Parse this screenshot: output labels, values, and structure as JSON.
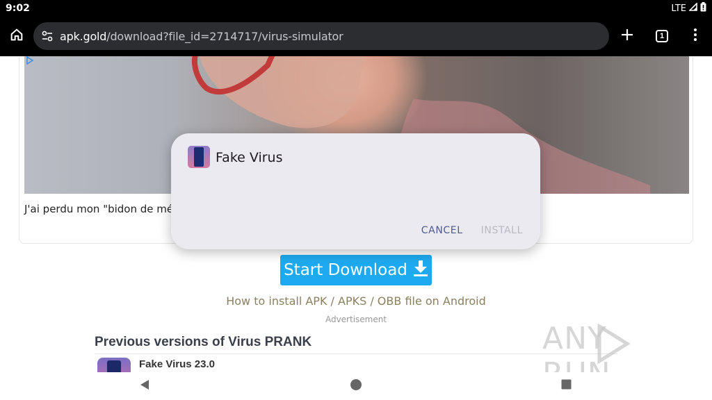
{
  "status_bar": {
    "time": "9:02",
    "network": "LTE"
  },
  "browser": {
    "url_domain": "apk.gold",
    "url_path": "/download?file_id=2714717/virus-simulator",
    "tab_count": "1"
  },
  "page": {
    "ad_caption": "J'ai perdu mon \"bidon de méne",
    "start_download_label": "Start Download",
    "how_to_link": "How to install APK / APKS / OBB file on Android",
    "ad_label": "Advertisement",
    "previous_versions_title": "Previous versions of Virus PRANK",
    "previous_versions": [
      {
        "name": "Fake Virus 23.0"
      }
    ]
  },
  "dialog": {
    "app_name": "Fake Virus",
    "cancel_label": "CANCEL",
    "install_label": "INSTALL"
  },
  "watermark": {
    "text": "ANY RUN"
  },
  "colors": {
    "accent_button": "#1eaaf0",
    "link": "#8a8060",
    "dialog_bg": "#eceaf1",
    "cancel": "#4c5b8c",
    "install_disabled": "#b8b8c0"
  },
  "icons": {
    "home": "home-icon",
    "site_info": "tune-icon",
    "new_tab": "plus-icon",
    "tabs": "tab-switcher-icon",
    "menu": "more-vertical-icon",
    "download": "download-arrow-icon",
    "nav_back": "triangle-back-icon",
    "nav_home": "circle-home-icon",
    "nav_recents": "square-recents-icon"
  }
}
